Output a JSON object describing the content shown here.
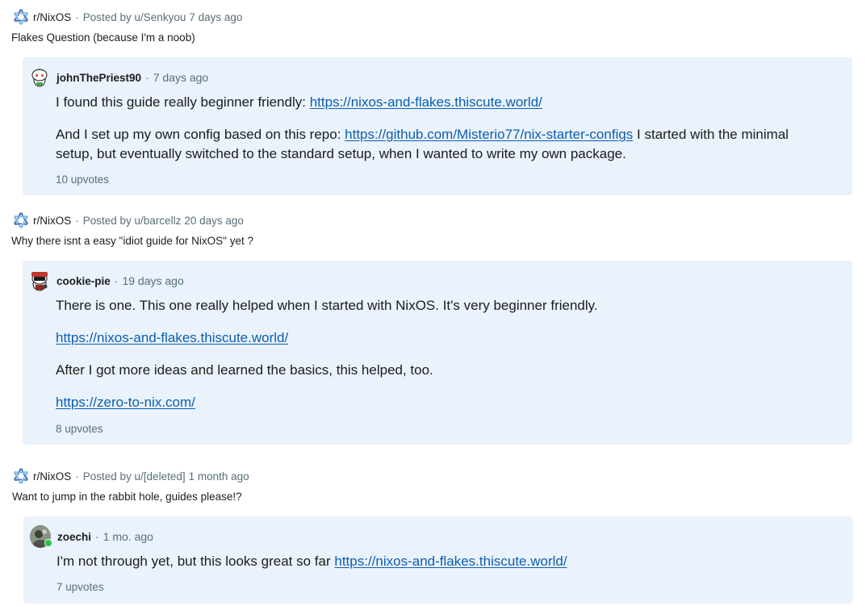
{
  "posts": [
    {
      "subreddit": "r/NixOS",
      "posted_by": "Posted by u/Senkyou",
      "age": "7 days ago",
      "title": "Flakes Question (because I'm a noob)",
      "comment": {
        "username": "johnThePriest90",
        "age": "7 days ago",
        "upvotes": "10 upvotes",
        "p1_text": "I found this guide really beginner friendly: ",
        "p1_link": "https://nixos-and-flakes.thiscute.world/",
        "p2_text_a": "And I set up my own config based on this repo: ",
        "p2_link": "https://github.com/Misterio77/nix-starter-configs",
        "p2_text_b": " I started with the minimal setup, but eventually switched to the standard setup, when I wanted to write my own package."
      }
    },
    {
      "subreddit": "r/NixOS",
      "posted_by": "Posted by u/barcellz",
      "age": "20 days ago",
      "title": "Why there isnt a easy \"idiot guide for NixOS\" yet ?",
      "comment": {
        "username": "cookie-pie",
        "age": "19 days ago",
        "upvotes": "8 upvotes",
        "p1_text": "There is one. This one really helped when I started with NixOS. It's very beginner friendly.",
        "p2_link": "https://nixos-and-flakes.thiscute.world/",
        "p3_text": "After I got more ideas and learned the basics, this helped, too.",
        "p4_link": "https://zero-to-nix.com/"
      }
    },
    {
      "subreddit": "r/NixOS",
      "posted_by": "Posted by u/[deleted]",
      "age": "1 month ago",
      "title": "Want to jump in the rabbit hole, guides please!?",
      "comment": {
        "username": "zoechi",
        "age": "1 mo. ago",
        "upvotes": "7 upvotes",
        "p1_text": "I'm not through yet, but this looks great so far ",
        "p1_link": "https://nixos-and-flakes.thiscute.world/"
      }
    }
  ],
  "separator": "·",
  "icons": {
    "subreddit": "nixos-snowflake-icon",
    "avatar_1": "snoo-avatar-icon",
    "avatar_2": "snoo-avatar-icon",
    "avatar_3": "user-avatar-icon"
  },
  "colors": {
    "comment_bg": "#eaf2fb",
    "link": "#0b5fb0",
    "meta": "#576f76",
    "nix_light": "#7ebae4",
    "nix_dark": "#5277c3",
    "online": "#2fbf4a"
  }
}
